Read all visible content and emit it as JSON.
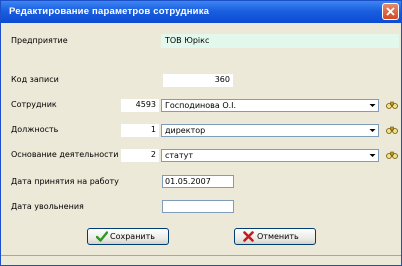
{
  "window": {
    "title": "Редактирование параметров сотрудника"
  },
  "enterprise": {
    "label": "Предприятие",
    "value": "ТОВ Юрікс"
  },
  "record": {
    "label": "Код записи",
    "value": "360"
  },
  "employee": {
    "label": "Сотрудник",
    "code": "4593",
    "value": "Господинова О.І."
  },
  "position": {
    "label": "Должность",
    "code": "1",
    "value": "директор"
  },
  "basis": {
    "label": "Основание деятельности",
    "code": "2",
    "value": "статут"
  },
  "hire_date": {
    "label": "Дата принятия на работу",
    "value": "01.05.2007"
  },
  "dismissal_date": {
    "label": "Дата увольнения",
    "value": ""
  },
  "buttons": {
    "save": "Сохранить",
    "cancel": "Отменить"
  },
  "icons": {
    "close": "close-icon",
    "lookup": "binoculars-icon",
    "dropdown": "chevron-down-icon",
    "save": "checkmark-icon",
    "cancel": "x-icon"
  },
  "colors": {
    "titlebar": "#0c4bd2",
    "enterprise_band": "#e3f8ec",
    "save_icon": "#2a9a1e",
    "cancel_icon": "#c8191e"
  }
}
